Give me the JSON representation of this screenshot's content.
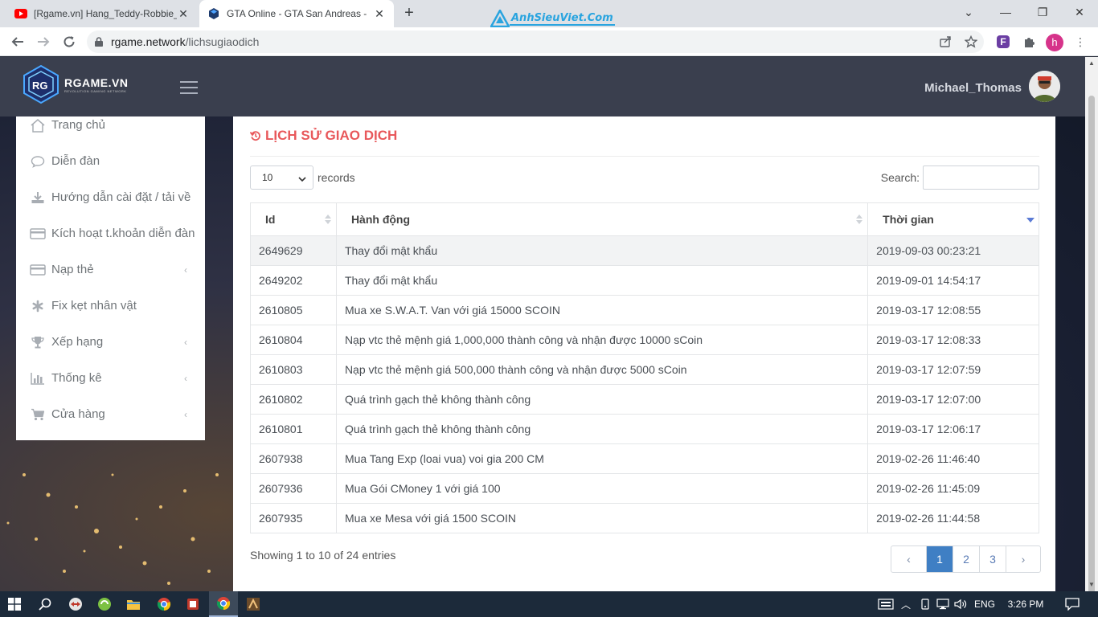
{
  "browser": {
    "tabs": [
      {
        "title": "[Rgame.vn] Hang_Teddy-Robbie_",
        "icon": "youtube-icon",
        "active": false
      },
      {
        "title": "GTA Online - GTA San Andreas - ",
        "icon": "gta-cube-icon",
        "active": true
      }
    ],
    "watermark": "AnhSieuViet.Com",
    "url_host": "rgame.network",
    "url_path": "/lichsugiaodich",
    "profile_initial": "h"
  },
  "header": {
    "brand": "RGAME.VN",
    "tagline": "REVOLUTION GAMING NETWORK",
    "username": "Michael_Thomas"
  },
  "sidebar": {
    "items": [
      {
        "label": "Trang chủ",
        "icon": "home-icon",
        "has_sub": false
      },
      {
        "label": "Diễn đàn",
        "icon": "comment-icon",
        "has_sub": false
      },
      {
        "label": "Hướng dẫn cài đặt / tải về",
        "icon": "download-icon",
        "has_sub": false
      },
      {
        "label": "Kích hoạt t.khoản diễn đàn",
        "icon": "credit-card-icon",
        "has_sub": false
      },
      {
        "label": "Nạp thẻ",
        "icon": "credit-card-icon",
        "has_sub": true
      },
      {
        "label": "Fix kẹt nhân vật",
        "icon": "asterisk-icon",
        "has_sub": false
      },
      {
        "label": "Xếp hạng",
        "icon": "trophy-icon",
        "has_sub": true
      },
      {
        "label": "Thống kê",
        "icon": "bar-chart-icon",
        "has_sub": true
      },
      {
        "label": "Cửa hàng",
        "icon": "cart-icon",
        "has_sub": true
      }
    ]
  },
  "main": {
    "title": "LỊCH SỬ GIAO DỊCH",
    "length_value": "10",
    "length_suffix": "records",
    "search_label": "Search:",
    "search_value": "",
    "columns": [
      "Id",
      "Hành động",
      "Thời gian"
    ],
    "rows": [
      [
        "2649629",
        "Thay đổi mật khẩu",
        "2019-09-03 00:23:21"
      ],
      [
        "2649202",
        "Thay đổi mật khẩu",
        "2019-09-01 14:54:17"
      ],
      [
        "2610805",
        "Mua xe S.W.A.T. Van với giá 15000 SCOIN",
        "2019-03-17 12:08:55"
      ],
      [
        "2610804",
        "Nạp vtc thẻ mệnh giá 1,000,000 thành công và nhận được 10000 sCoin",
        "2019-03-17 12:08:33"
      ],
      [
        "2610803",
        "Nạp vtc thẻ mệnh giá 500,000 thành công và nhận được 5000 sCoin",
        "2019-03-17 12:07:59"
      ],
      [
        "2610802",
        "Quá trình gạch thẻ không thành công",
        "2019-03-17 12:07:00"
      ],
      [
        "2610801",
        "Quá trình gạch thẻ không thành công",
        "2019-03-17 12:06:17"
      ],
      [
        "2607938",
        "Mua Tang Exp (loai vua) voi gia 200 CM",
        "2019-02-26 11:46:40"
      ],
      [
        "2607936",
        "Mua Gói CMoney 1 với giá 100",
        "2019-02-26 11:45:09"
      ],
      [
        "2607935",
        "Mua xe Mesa với giá 1500 SCOIN",
        "2019-02-26 11:44:58"
      ]
    ],
    "info": "Showing 1 to 10 of 24 entries",
    "pagination": {
      "prev": "‹",
      "pages": [
        "1",
        "2",
        "3"
      ],
      "current": "1",
      "next": "›"
    }
  },
  "taskbar": {
    "language": "ENG",
    "time": "3:26 PM"
  }
}
